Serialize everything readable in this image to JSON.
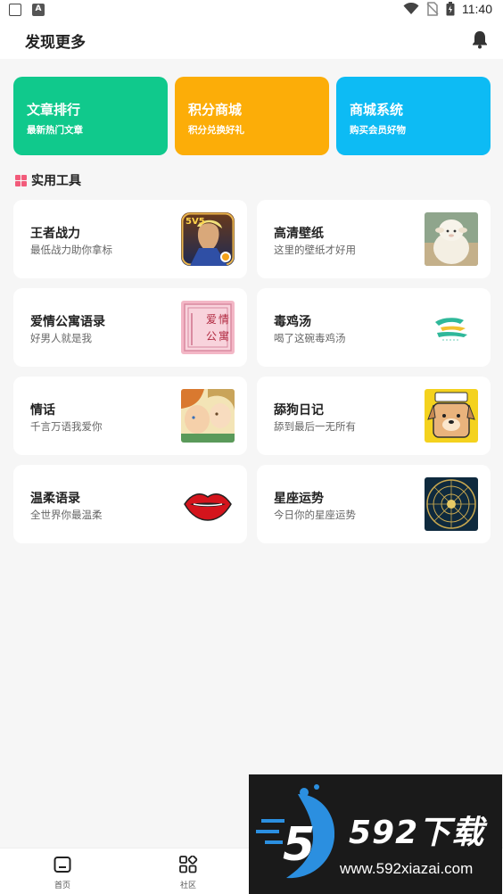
{
  "status_bar": {
    "time": "11:40"
  },
  "header": {
    "title": "发现更多"
  },
  "features": [
    {
      "title": "文章排行",
      "subtitle": "最新热门文章",
      "color": "#10c98c"
    },
    {
      "title": "积分商城",
      "subtitle": "积分兑换好礼",
      "color": "#fcad08"
    },
    {
      "title": "商城系统",
      "subtitle": "购买会员好物",
      "color": "#0dbbf4"
    }
  ],
  "section": {
    "title": "实用工具",
    "icon_color": "#f25b7a"
  },
  "tools": [
    {
      "title": "王者战力",
      "subtitle": "最低战力助你拿标",
      "icon": "game-hero-icon"
    },
    {
      "title": "高清壁纸",
      "subtitle": "这里的壁纸才好用",
      "icon": "plush-sheep-icon"
    },
    {
      "title": "爱情公寓语录",
      "subtitle": "好男人就是我",
      "icon": "love-apartment-icon",
      "thumb_text": [
        "爱",
        "情",
        "公",
        "寓"
      ]
    },
    {
      "title": "毒鸡汤",
      "subtitle": "喝了这碗毒鸡汤",
      "icon": "soup-logo-icon"
    },
    {
      "title": "情话",
      "subtitle": "千言万语我爱你",
      "icon": "couple-illustration-icon"
    },
    {
      "title": "舔狗日记",
      "subtitle": "舔到最后一无所有",
      "icon": "dog-cartoon-icon"
    },
    {
      "title": "温柔语录",
      "subtitle": "全世界你最温柔",
      "icon": "red-lips-icon"
    },
    {
      "title": "星座运势",
      "subtitle": "今日你的星座运势",
      "icon": "zodiac-wheel-icon"
    }
  ],
  "bottom_nav": [
    {
      "label": "首页",
      "icon": "home-icon"
    },
    {
      "label": "社区",
      "icon": "community-grid-icon"
    }
  ],
  "watermark": {
    "big": "592下载",
    "url": "www.592xiazai.com"
  }
}
